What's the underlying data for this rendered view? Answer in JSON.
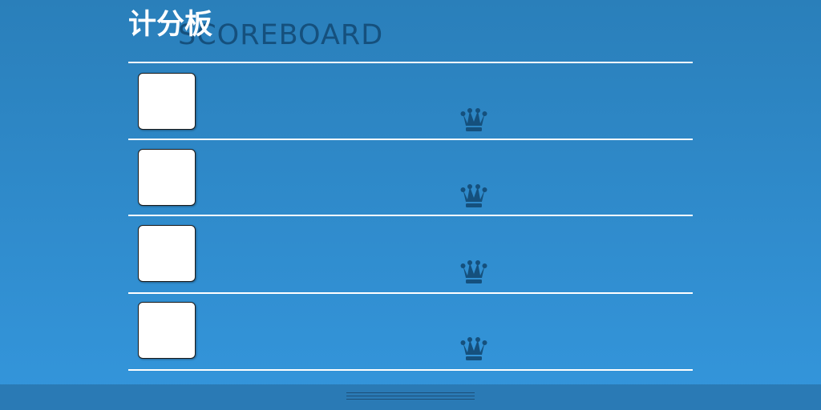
{
  "header": {
    "title": "计分板",
    "title_en": "SCOREBOARD"
  },
  "rows": [
    {
      "avatar": "player-avatar",
      "icon": "crown-icon"
    },
    {
      "avatar": "player-avatar",
      "icon": "crown-icon"
    },
    {
      "avatar": "player-avatar",
      "icon": "crown-icon"
    },
    {
      "avatar": "player-avatar",
      "icon": "crown-icon"
    }
  ],
  "colors": {
    "background_top": "#2a7fba",
    "background_bottom": "#3496dc",
    "title_shadow": "#15507d",
    "crown": "#15507d",
    "divider": "#ffffff",
    "footer": "#2a7ab5"
  },
  "footer": {
    "icon": "drag-handle-icon"
  }
}
